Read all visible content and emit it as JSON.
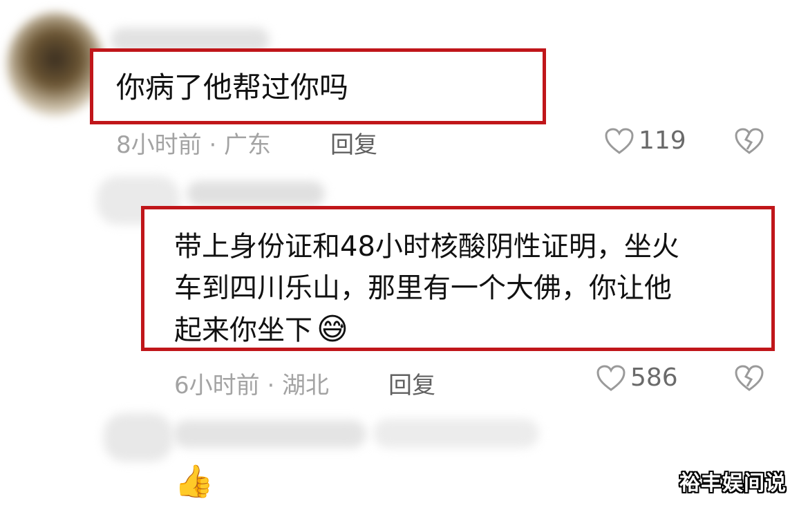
{
  "comments": [
    {
      "text_lines": [
        "你病了他帮过你吗"
      ],
      "time_location": "8小时前 · 广东",
      "reply_label": "回复",
      "likes": "119"
    },
    {
      "text_lines": [
        "带上身份证和48小时核酸阴性证明，坐火",
        "车到四川乐山，那里有一个大佛，你让他",
        "起来你坐下"
      ],
      "emoji": "😅",
      "time_location": "6小时前 · 湖北",
      "reply_label": "回复",
      "likes": "586"
    }
  ],
  "third_comment_emoji": "👍",
  "watermark": "裕丰娱间说",
  "colors": {
    "highlight_border": "#c0161a",
    "meta_text": "#a3a3a3",
    "reply_text": "#606060"
  },
  "icons": [
    "heart-outline-icon",
    "broken-heart-icon"
  ]
}
